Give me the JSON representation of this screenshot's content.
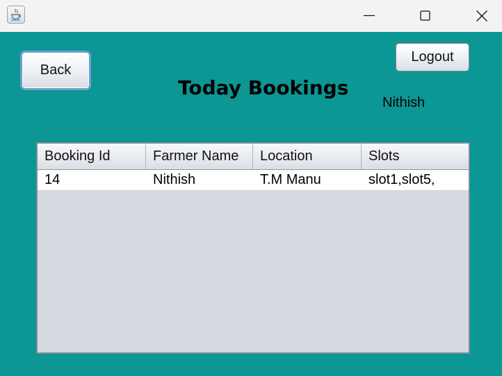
{
  "window": {
    "app_icon": "java-cup-icon",
    "controls": [
      "minimize-icon",
      "maximize-icon",
      "close-icon"
    ]
  },
  "toolbar": {
    "back_label": "Back",
    "logout_label": "Logout"
  },
  "header": {
    "title": "Today Bookings",
    "user": "Nithish"
  },
  "table": {
    "columns": [
      "Booking Id",
      "Farmer Name",
      "Location",
      "Slots"
    ],
    "rows": [
      [
        "14",
        "Nithish",
        "T.M Manu",
        "slot1,slot5,"
      ]
    ]
  },
  "colors": {
    "background": "#0c9694",
    "titlebar": "#f3f3f3",
    "table_empty": "#d6d9df"
  }
}
